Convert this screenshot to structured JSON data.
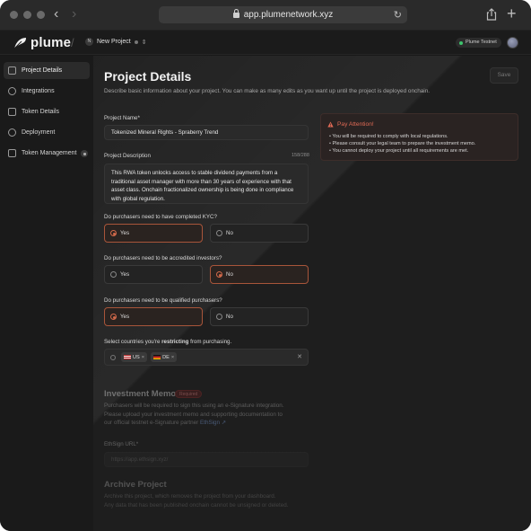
{
  "browser": {
    "url": "app.plumenetwork.xyz",
    "back_icon": "chevron-left-icon",
    "forward_icon": "chevron-right-icon",
    "reload_icon": "reload-icon",
    "share_icon": "share-icon",
    "new_tab_icon": "plus-icon"
  },
  "header": {
    "logo_text": "plume",
    "project_initial": "N",
    "project_name": "New Project",
    "network": "Plume Testnet"
  },
  "sidebar": {
    "items": [
      {
        "label": "Project Details",
        "icon": "document-icon"
      },
      {
        "label": "Integrations",
        "icon": "link-icon"
      },
      {
        "label": "Token Details",
        "icon": "token-icon"
      },
      {
        "label": "Deployment",
        "icon": "globe-icon"
      },
      {
        "label": "Token Management",
        "icon": "list-icon"
      }
    ]
  },
  "page": {
    "title": "Project Details",
    "subtitle": "Describe basic information about your project. You can make as many edits as you want up until the project is deployed onchain.",
    "save_label": "Save"
  },
  "form": {
    "name_label": "Project Name*",
    "name_value": "Tokenized Mineral Rights - Spraberry Trend",
    "description_label": "Project Description",
    "description_counter": "158/288",
    "description_value": "This RWA token unlocks access to stable dividend payments from a traditional asset manager with more than 30 years of experience with that asset class. Onchain fractionalized ownership is being done in compliance with global regulation.",
    "kyc_question": "Do purchasers need to have completed KYC?",
    "accredited_question": "Do purchasers need to be accredited investors?",
    "qualified_question": "Do purchasers need to be qualified purchasers?",
    "yes_label": "Yes",
    "no_label": "No",
    "kyc_answer": "Yes",
    "accredited_answer": "No",
    "qualified_answer": "Yes",
    "countries_label_pre": "Select countries you're ",
    "countries_label_bold": "restricting",
    "countries_label_post": " from purchasing.",
    "countries": [
      "US",
      "DE"
    ]
  },
  "attention": {
    "title": "Pay Attention!",
    "items": [
      "You will be required to comply with local regulations.",
      "Please consult your legal team to prepare the investment memo.",
      "You cannot deploy your project until all requirements are met."
    ]
  },
  "memo": {
    "title": "Investment Memo",
    "badge": "Required",
    "line1": "Purchasers will be required to sign this using an e-Signature integration.",
    "line2": "Please upload your investment memo and supporting documentation to",
    "line3_pre": "our official testnet e-Signature partner ",
    "link": "EthSign ↗",
    "url_label": "EthSign URL*",
    "url_placeholder": "https://app.ethsign.xyz/"
  },
  "archive": {
    "title": "Archive Project",
    "line1": "Archive this project, which removes the project from your dashboard.",
    "line2": "Any data that has been published onchain cannot be unsigned or deleted."
  },
  "colors": {
    "accent": "#d2694a",
    "warning": "#e06a55",
    "network_dot": "#3ec46d"
  }
}
